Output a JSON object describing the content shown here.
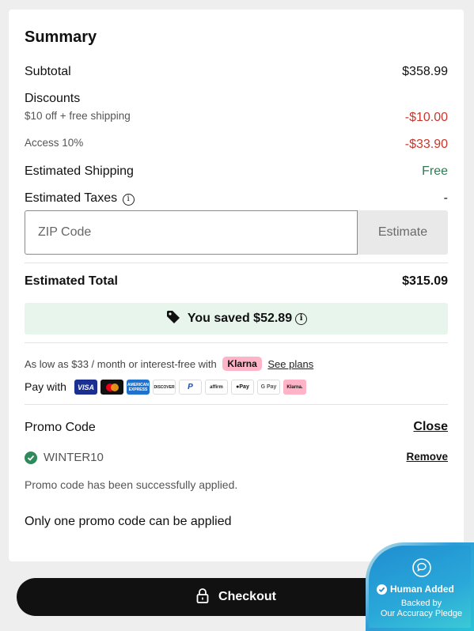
{
  "summary": {
    "title": "Summary",
    "subtotal_label": "Subtotal",
    "subtotal_value": "$358.99",
    "discounts_label": "Discounts",
    "discount1_label": "$10 off + free shipping",
    "discount1_value": "-$10.00",
    "discount2_label": "Access 10%",
    "discount2_value": "-$33.90",
    "shipping_label": "Estimated Shipping",
    "shipping_value": "Free",
    "taxes_label": "Estimated Taxes",
    "taxes_value": "-",
    "zip_placeholder": "ZIP Code",
    "estimate_button": "Estimate",
    "total_label": "Estimated Total",
    "total_value": "$315.09",
    "saved_text": "You saved $52.89"
  },
  "financing": {
    "text": "As low as $33 / month or interest-free with",
    "klarna": "Klarna",
    "see_plans": "See plans",
    "pay_with": "Pay with",
    "methods": [
      "VISA",
      "Mastercard",
      "American Express",
      "DISCOVER",
      "PayPal",
      "affirm",
      "Apple Pay",
      "Google Pay",
      "Klarna."
    ]
  },
  "promo": {
    "label": "Promo Code",
    "close": "Close",
    "code": "WINTER10",
    "remove": "Remove",
    "success": "Promo code has been successfully applied.",
    "note": "Only one promo code can be applied"
  },
  "checkout": {
    "label": "Checkout"
  },
  "human_badge": {
    "title": "Human Added",
    "line1": "Backed by",
    "line2": "Our Accuracy Pledge"
  },
  "colors": {
    "discount": "#c8372d",
    "free": "#2f7a52",
    "saved_bg": "#e8f5ec",
    "checkout_bg": "#111111"
  }
}
